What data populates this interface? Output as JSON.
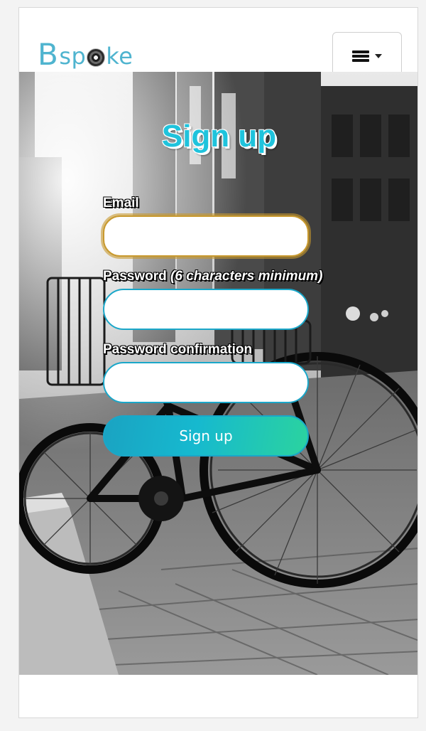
{
  "navbar": {
    "brand": {
      "first_letter": "B",
      "before_wheel": "sp",
      "after_wheel": "ke"
    },
    "toggler": {
      "icon": "hamburger-icon",
      "caret": "caret-down-icon"
    }
  },
  "signup": {
    "title": "Sign up",
    "email_label": "Email",
    "email_value": "",
    "password_label": "Password",
    "password_hint": "(6 characters minimum)",
    "password_value": "",
    "confirmation_label": "Password confirmation",
    "confirmation_value": "",
    "submit_label": "Sign up"
  },
  "colors": {
    "accent": "#1fc3dc",
    "input_border": "#1aa7c9",
    "focus_ring": "#c8992e",
    "button_gradient_start": "#1aa3c2",
    "button_gradient_end": "#2bd39f"
  }
}
